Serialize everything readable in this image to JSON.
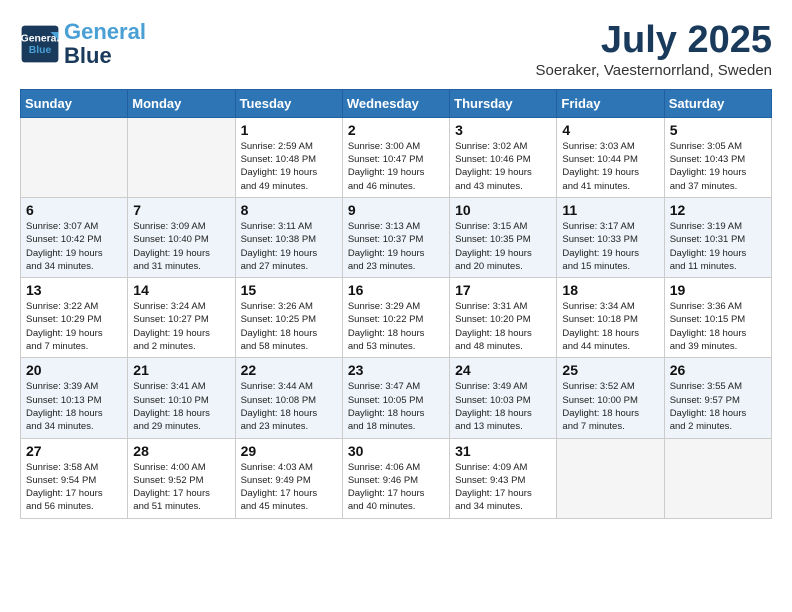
{
  "header": {
    "logo_line1": "General",
    "logo_line2": "Blue",
    "month_title": "July 2025",
    "subtitle": "Soeraker, Vaesternorrland, Sweden"
  },
  "weekdays": [
    "Sunday",
    "Monday",
    "Tuesday",
    "Wednesday",
    "Thursday",
    "Friday",
    "Saturday"
  ],
  "weeks": [
    [
      {
        "day": "",
        "info": ""
      },
      {
        "day": "",
        "info": ""
      },
      {
        "day": "1",
        "info": "Sunrise: 2:59 AM\nSunset: 10:48 PM\nDaylight: 19 hours\nand 49 minutes."
      },
      {
        "day": "2",
        "info": "Sunrise: 3:00 AM\nSunset: 10:47 PM\nDaylight: 19 hours\nand 46 minutes."
      },
      {
        "day": "3",
        "info": "Sunrise: 3:02 AM\nSunset: 10:46 PM\nDaylight: 19 hours\nand 43 minutes."
      },
      {
        "day": "4",
        "info": "Sunrise: 3:03 AM\nSunset: 10:44 PM\nDaylight: 19 hours\nand 41 minutes."
      },
      {
        "day": "5",
        "info": "Sunrise: 3:05 AM\nSunset: 10:43 PM\nDaylight: 19 hours\nand 37 minutes."
      }
    ],
    [
      {
        "day": "6",
        "info": "Sunrise: 3:07 AM\nSunset: 10:42 PM\nDaylight: 19 hours\nand 34 minutes."
      },
      {
        "day": "7",
        "info": "Sunrise: 3:09 AM\nSunset: 10:40 PM\nDaylight: 19 hours\nand 31 minutes."
      },
      {
        "day": "8",
        "info": "Sunrise: 3:11 AM\nSunset: 10:38 PM\nDaylight: 19 hours\nand 27 minutes."
      },
      {
        "day": "9",
        "info": "Sunrise: 3:13 AM\nSunset: 10:37 PM\nDaylight: 19 hours\nand 23 minutes."
      },
      {
        "day": "10",
        "info": "Sunrise: 3:15 AM\nSunset: 10:35 PM\nDaylight: 19 hours\nand 20 minutes."
      },
      {
        "day": "11",
        "info": "Sunrise: 3:17 AM\nSunset: 10:33 PM\nDaylight: 19 hours\nand 15 minutes."
      },
      {
        "day": "12",
        "info": "Sunrise: 3:19 AM\nSunset: 10:31 PM\nDaylight: 19 hours\nand 11 minutes."
      }
    ],
    [
      {
        "day": "13",
        "info": "Sunrise: 3:22 AM\nSunset: 10:29 PM\nDaylight: 19 hours\nand 7 minutes."
      },
      {
        "day": "14",
        "info": "Sunrise: 3:24 AM\nSunset: 10:27 PM\nDaylight: 19 hours\nand 2 minutes."
      },
      {
        "day": "15",
        "info": "Sunrise: 3:26 AM\nSunset: 10:25 PM\nDaylight: 18 hours\nand 58 minutes."
      },
      {
        "day": "16",
        "info": "Sunrise: 3:29 AM\nSunset: 10:22 PM\nDaylight: 18 hours\nand 53 minutes."
      },
      {
        "day": "17",
        "info": "Sunrise: 3:31 AM\nSunset: 10:20 PM\nDaylight: 18 hours\nand 48 minutes."
      },
      {
        "day": "18",
        "info": "Sunrise: 3:34 AM\nSunset: 10:18 PM\nDaylight: 18 hours\nand 44 minutes."
      },
      {
        "day": "19",
        "info": "Sunrise: 3:36 AM\nSunset: 10:15 PM\nDaylight: 18 hours\nand 39 minutes."
      }
    ],
    [
      {
        "day": "20",
        "info": "Sunrise: 3:39 AM\nSunset: 10:13 PM\nDaylight: 18 hours\nand 34 minutes."
      },
      {
        "day": "21",
        "info": "Sunrise: 3:41 AM\nSunset: 10:10 PM\nDaylight: 18 hours\nand 29 minutes."
      },
      {
        "day": "22",
        "info": "Sunrise: 3:44 AM\nSunset: 10:08 PM\nDaylight: 18 hours\nand 23 minutes."
      },
      {
        "day": "23",
        "info": "Sunrise: 3:47 AM\nSunset: 10:05 PM\nDaylight: 18 hours\nand 18 minutes."
      },
      {
        "day": "24",
        "info": "Sunrise: 3:49 AM\nSunset: 10:03 PM\nDaylight: 18 hours\nand 13 minutes."
      },
      {
        "day": "25",
        "info": "Sunrise: 3:52 AM\nSunset: 10:00 PM\nDaylight: 18 hours\nand 7 minutes."
      },
      {
        "day": "26",
        "info": "Sunrise: 3:55 AM\nSunset: 9:57 PM\nDaylight: 18 hours\nand 2 minutes."
      }
    ],
    [
      {
        "day": "27",
        "info": "Sunrise: 3:58 AM\nSunset: 9:54 PM\nDaylight: 17 hours\nand 56 minutes."
      },
      {
        "day": "28",
        "info": "Sunrise: 4:00 AM\nSunset: 9:52 PM\nDaylight: 17 hours\nand 51 minutes."
      },
      {
        "day": "29",
        "info": "Sunrise: 4:03 AM\nSunset: 9:49 PM\nDaylight: 17 hours\nand 45 minutes."
      },
      {
        "day": "30",
        "info": "Sunrise: 4:06 AM\nSunset: 9:46 PM\nDaylight: 17 hours\nand 40 minutes."
      },
      {
        "day": "31",
        "info": "Sunrise: 4:09 AM\nSunset: 9:43 PM\nDaylight: 17 hours\nand 34 minutes."
      },
      {
        "day": "",
        "info": ""
      },
      {
        "day": "",
        "info": ""
      }
    ]
  ]
}
